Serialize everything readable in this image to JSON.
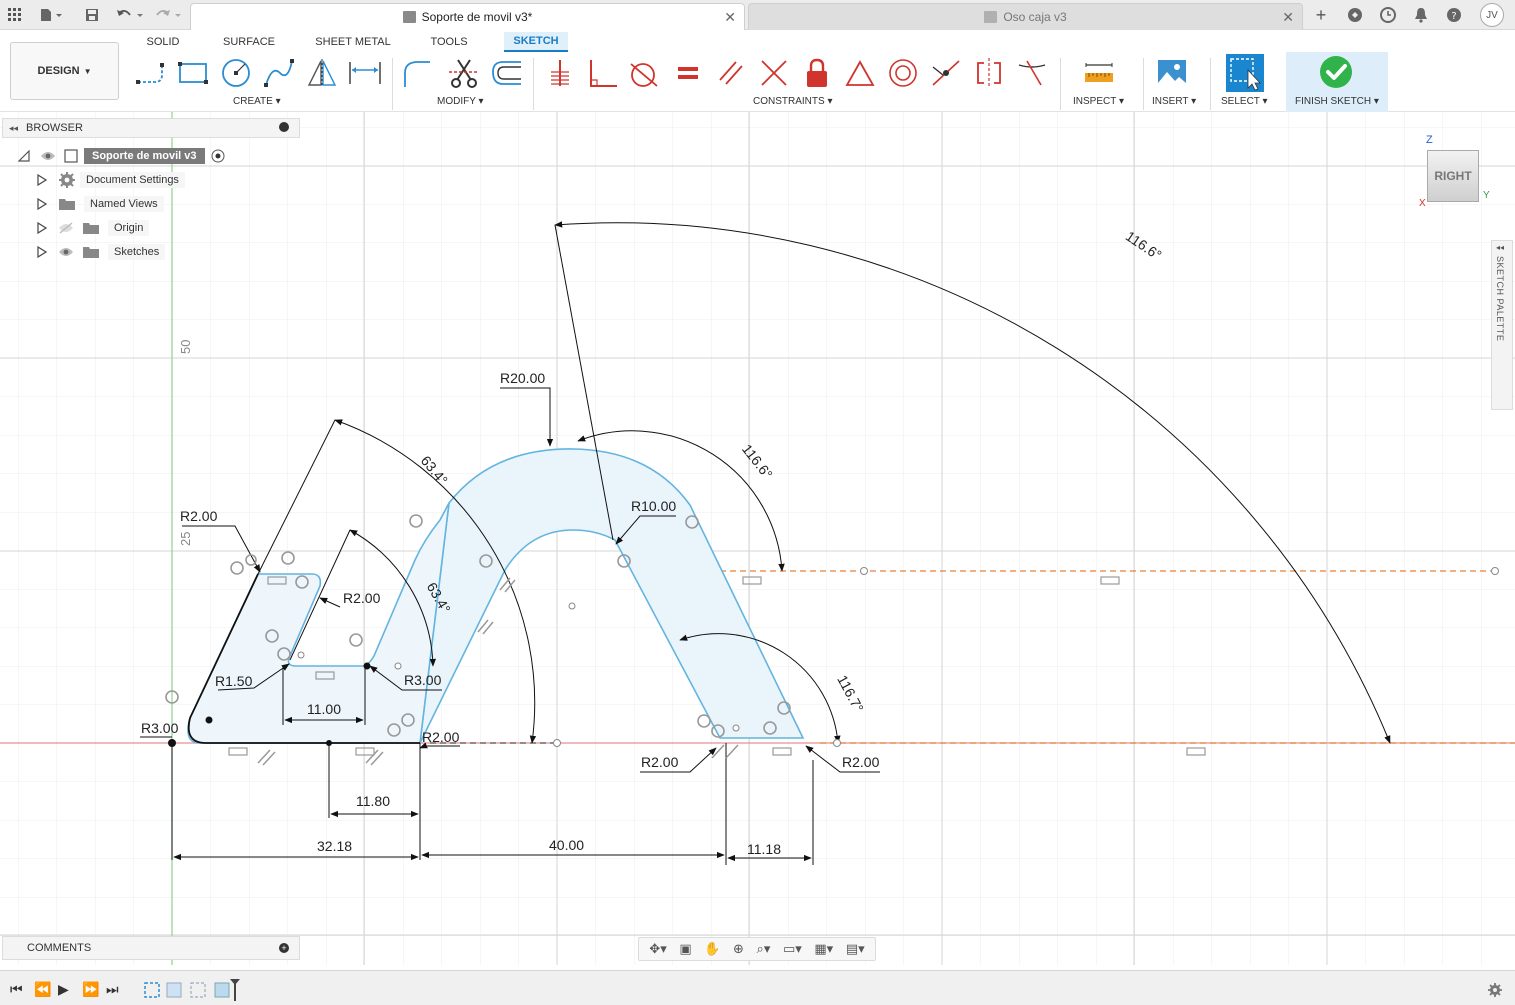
{
  "topbar": {
    "tabs": [
      {
        "label": "Soporte de movil v3*",
        "active": true
      },
      {
        "label": "Oso caja v3",
        "active": false
      }
    ],
    "user_initials": "JV"
  },
  "ribbon": {
    "workspace": "DESIGN",
    "tabs": [
      "SOLID",
      "SURFACE",
      "SHEET METAL",
      "TOOLS",
      "SKETCH"
    ],
    "active_tab": "SKETCH",
    "groups": {
      "create": "CREATE",
      "modify": "MODIFY",
      "constraints": "CONSTRAINTS",
      "inspect": "INSPECT",
      "insert": "INSERT",
      "select": "SELECT",
      "finish": "FINISH SKETCH"
    },
    "accent_color": "#1a7dc4",
    "finish_color": "#2fb34a"
  },
  "browser": {
    "title": "BROWSER",
    "root": "Soporte de movil v3",
    "items": [
      "Document Settings",
      "Named Views",
      "Origin",
      "Sketches"
    ]
  },
  "comments": {
    "title": "COMMENTS"
  },
  "viewcube": {
    "face": "RIGHT",
    "axis_z": "Z",
    "axis_y": "Y",
    "axis_x": "X"
  },
  "sketch_palette": {
    "label": "SKETCH PALETTE"
  },
  "sketch": {
    "grid_labels": [
      "50",
      "25"
    ],
    "dimensions": {
      "r20": "R20.00",
      "r10": "R10.00",
      "r2_top": "R2.00",
      "r2_inner": "R2.00",
      "r150": "R1.50",
      "r3_inner": "R3.00",
      "r3_corner": "R3.00",
      "r2_base": "R2.00",
      "r2_foot_left": "R2.00",
      "r2_foot_right": "R2.00",
      "angle_big": "116.6°",
      "angle_arch": "116.6°",
      "angle_foot": "116.7°",
      "angle_outer": "63.4°",
      "angle_inner": "63.4°",
      "d11": "11.00",
      "d1180": "11.80",
      "d3218": "32.18",
      "d40": "40.00",
      "d1118": "11.18"
    }
  }
}
